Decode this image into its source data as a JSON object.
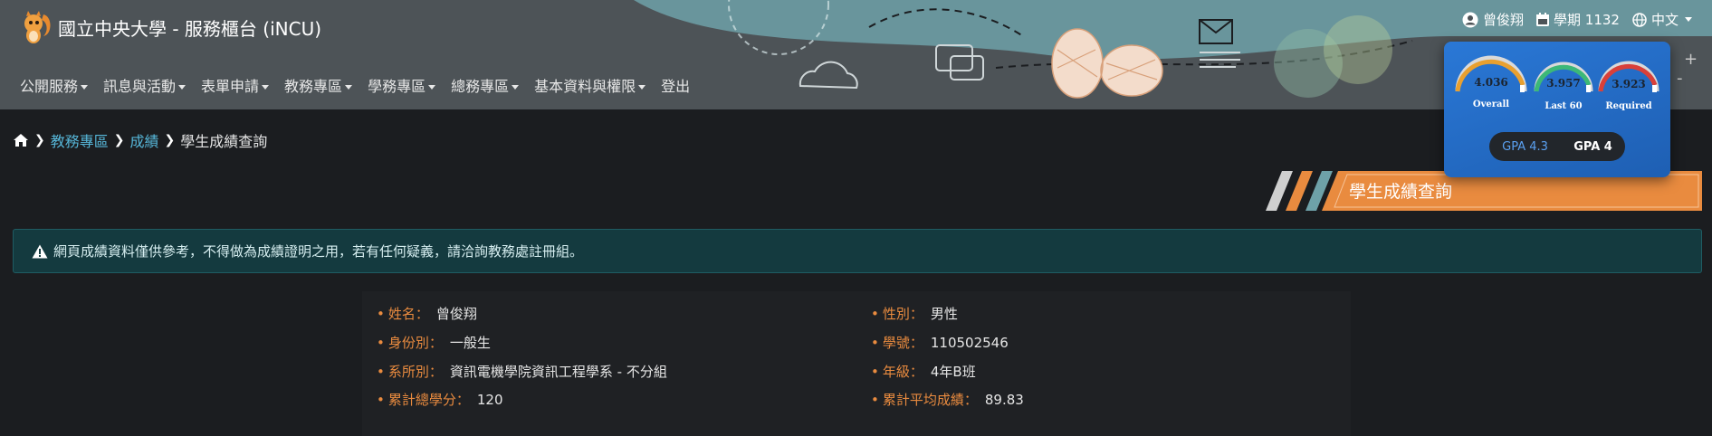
{
  "app": {
    "title": "國立中央大學 - 服務櫃台 (iNCU)"
  },
  "nav": {
    "items": [
      {
        "label": "公開服務",
        "dropdown": true
      },
      {
        "label": "訊息與活動",
        "dropdown": true
      },
      {
        "label": "表單申請",
        "dropdown": true
      },
      {
        "label": "教務專區",
        "dropdown": true
      },
      {
        "label": "學務專區",
        "dropdown": true
      },
      {
        "label": "總務專區",
        "dropdown": true
      },
      {
        "label": "基本資料與權限",
        "dropdown": true
      },
      {
        "label": "登出",
        "dropdown": false
      }
    ]
  },
  "userbar": {
    "user_name": "曾俊翔",
    "semester": "學期 1132",
    "language": "中文"
  },
  "gpa_card": {
    "gauges": [
      {
        "value": "4.036",
        "label": "Overall",
        "color": "#e8a030"
      },
      {
        "value": "3.957",
        "label": "Last 60",
        "color": "#3cb878"
      },
      {
        "value": "3.923",
        "label": "Required",
        "color": "#d8403a"
      }
    ],
    "toggle": {
      "option_a": "GPA 4.3",
      "option_b": "GPA 4"
    }
  },
  "breadcrumb": {
    "items": [
      "教務專區",
      "成績"
    ],
    "current": "學生成績查詢"
  },
  "page_title": "學生成績查詢",
  "alert": {
    "text": "網頁成績資料僅供參考，不得做為成績證明之用，若有任何疑義，請洽詢教務處註冊組。"
  },
  "student": {
    "left": [
      {
        "label": "姓名：",
        "value": "曾俊翔"
      },
      {
        "label": "身份別：",
        "value": "一般生"
      },
      {
        "label": "系所別：",
        "value": "資訊電機學院資訊工程學系 - 不分組"
      },
      {
        "label": "累計總學分：",
        "value": "120"
      }
    ],
    "right": [
      {
        "label": "性別：",
        "value": "男性"
      },
      {
        "label": "學號：",
        "value": "110502546"
      },
      {
        "label": "年級：",
        "value": "4年B班"
      },
      {
        "label": "累計平均成績：",
        "value": "89.83"
      }
    ]
  },
  "colors": {
    "accent_orange": "#e98b3f",
    "link_blue": "#56b6d8",
    "header_bg": "#4d5357",
    "alert_bg": "#143a3f"
  }
}
